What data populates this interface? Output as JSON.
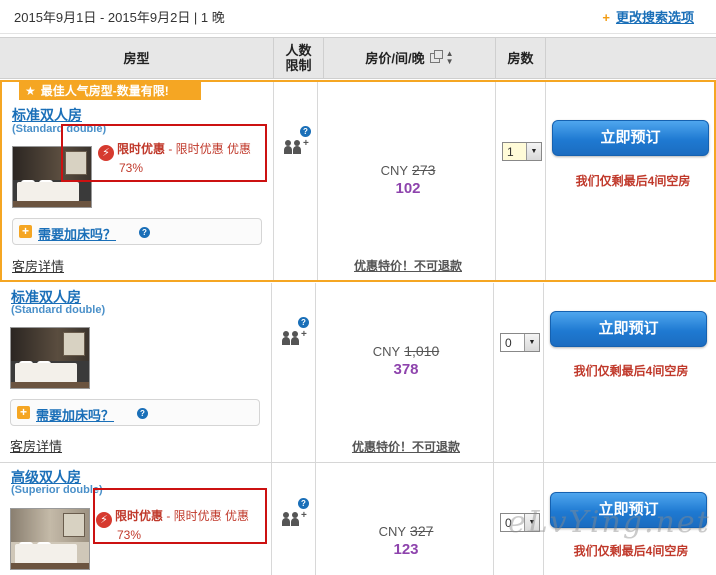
{
  "top": {
    "dates": "2015年9月1日 - 2015年9月2日 | 1 晚",
    "change_search": "更改搜索选项",
    "change_icon": "plus-icon"
  },
  "table_header": {
    "room_type": "房型",
    "occupancy": "人数\n限制",
    "price": "房价/间/晚",
    "rooms": "房数"
  },
  "rows": [
    {
      "ribbon": "最佳人气房型-数量有限!",
      "name": "标准双人房",
      "english": "(Standard double)",
      "promo_title": "限时优惠",
      "promo_text": " - 限时优惠 优惠",
      "promo_percent": "73%",
      "add_bed": "需要加床吗？",
      "details": "客房详情",
      "currency": "CNY",
      "old_price": "273",
      "new_price": "102",
      "special": "优惠特价！不可退款",
      "qty": "1",
      "book_label": "立即预订",
      "remaining": "我们仅剩最后4间空房"
    },
    {
      "name": "标准双人房",
      "english": "(Standard double)",
      "add_bed": "需要加床吗？",
      "details": "客房详情",
      "currency": "CNY",
      "old_price": "1,010",
      "new_price": "378",
      "special": "优惠特价！不可退款",
      "qty": "0",
      "book_label": "立即预订",
      "remaining": "我们仅剩最后4间空房"
    },
    {
      "name": "高级双人房",
      "english": "(Superior double)",
      "promo_title": "限时优惠",
      "promo_text": " - 限时优惠 优惠",
      "promo_percent": "73%",
      "currency": "CNY",
      "old_price": "327",
      "new_price": "123",
      "qty": "0",
      "book_label": "立即预订",
      "remaining": "我们仅剩最后4间空房"
    }
  ],
  "watermark": "eLvYing.net",
  "colors": {
    "accent_blue": "#1a6fb8",
    "featured_orange": "#f5a623",
    "price_purple": "#8e44ad",
    "alert_red": "#c0392b"
  }
}
